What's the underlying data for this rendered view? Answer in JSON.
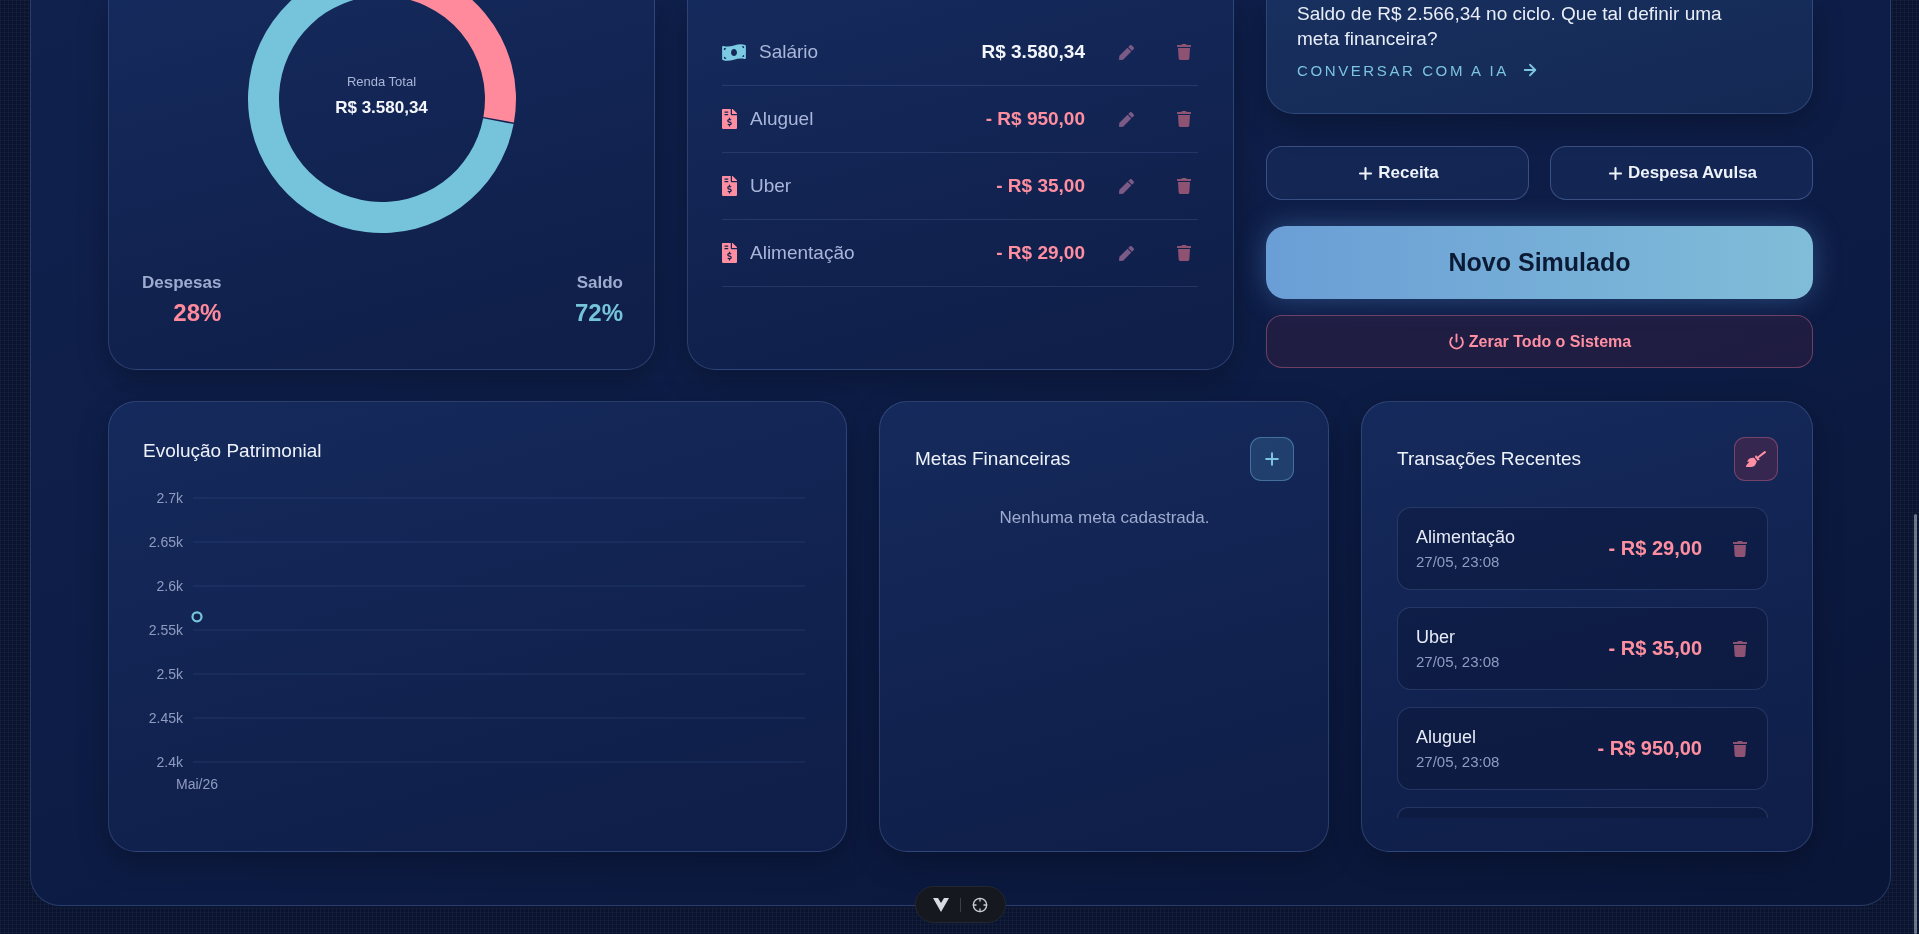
{
  "summary_card": {
    "center_label": "Renda Total",
    "center_value": "R$ 3.580,34",
    "chart_data": {
      "type": "donut",
      "categories": [
        "Despesas",
        "Saldo"
      ],
      "values": [
        28,
        72
      ]
    },
    "stats": [
      {
        "value": "28%",
        "color": "#ff8a9b"
      },
      {
        "value": "72%",
        "color": "#76c4dc"
      }
    ]
  },
  "entries": [
    {
      "kind": "income",
      "name": "Salário",
      "amount": "R$ 3.580,34"
    },
    {
      "kind": "expense",
      "name": "Aluguel",
      "amount": "- R$ 950,00"
    },
    {
      "kind": "expense",
      "name": "Uber",
      "amount": "- R$ 35,00"
    },
    {
      "kind": "expense",
      "name": "Alimentação",
      "amount": "- R$ 29,00"
    }
  ],
  "assistant_card": {
    "message": "Saldo de R$ 2.566,34 no ciclo. Que tal definir uma meta financeira?",
    "link": "CONVERSAR COM A IA"
  },
  "actions": [
    {
      "kind": "add",
      "label": "Receita"
    },
    {
      "kind": "add",
      "label": "Despesa Avulsa"
    },
    {
      "kind": "primary",
      "label": "Novo Simulado"
    },
    {
      "kind": "reset",
      "label": "Zerar Todo o Sistema"
    }
  ],
  "chart_card": {
    "title": "Evolução Patrimonial",
    "chart_data": {
      "type": "line",
      "grid": true,
      "categories": [
        "Mai/26"
      ],
      "series": [
        {
          "color": "#76c4dc",
          "marker": "circle",
          "values": [
            2565
          ]
        }
      ],
      "ylim": [
        2400,
        2700
      ],
      "yticks": [
        {
          "value": 2700,
          "label": "2.7k"
        },
        {
          "value": 2650,
          "label": "2.65k"
        },
        {
          "value": 2600,
          "label": "2.6k"
        },
        {
          "value": 2550,
          "label": "2.55k"
        },
        {
          "value": 2500,
          "label": "2.5k"
        },
        {
          "value": 2450,
          "label": "2.45k"
        },
        {
          "value": 2400,
          "label": "2.4k"
        }
      ]
    }
  },
  "goals_card": {
    "title": "Metas Financeiras",
    "empty_text": "Nenhuma meta cadastrada."
  },
  "transactions_card": {
    "title": "Transações Recentes",
    "items": [
      {
        "kind": "expense",
        "name": "Alimentação",
        "time": "27/05, 23:08",
        "amount": "- R$ 29,00"
      },
      {
        "kind": "expense",
        "name": "Uber",
        "time": "27/05, 23:08",
        "amount": "- R$ 35,00"
      },
      {
        "kind": "expense",
        "name": "Aluguel",
        "time": "27/05, 23:08",
        "amount": "- R$ 950,00"
      }
    ]
  }
}
